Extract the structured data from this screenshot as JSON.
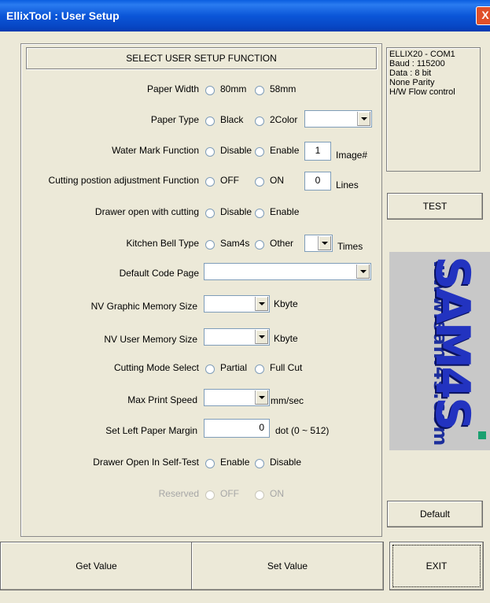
{
  "window": {
    "title": "EllixTool : User Setup",
    "close_glyph": "X"
  },
  "header": {
    "text": "SELECT USER SETUP FUNCTION"
  },
  "info": {
    "lines": [
      "ELLIX20 - COM1",
      "Baud : 115200",
      "Data : 8 bit",
      "None Parity",
      "H/W Flow control"
    ]
  },
  "buttons": {
    "test": "TEST",
    "default": "Default",
    "exit": "EXIT",
    "get_value": "Get Value",
    "set_value": "Set Value"
  },
  "logo": {
    "url": "www.sam4s.com",
    "brand": "SAM4S"
  },
  "rows": {
    "paper_width": {
      "label": "Paper Width",
      "opt1": "80mm",
      "opt2": "58mm"
    },
    "paper_type": {
      "label": "Paper Type",
      "opt1": "Black",
      "opt2": "2Color",
      "select": ""
    },
    "water_mark": {
      "label": "Water Mark Function",
      "opt1": "Disable",
      "opt2": "Enable",
      "value": "1",
      "unit": "Image#"
    },
    "cutting_pos": {
      "label": "Cutting postion adjustment Function",
      "opt1": "OFF",
      "opt2": "ON",
      "value": "0",
      "unit": "Lines"
    },
    "drawer_cut": {
      "label": "Drawer open with cutting",
      "opt1": "Disable",
      "opt2": "Enable"
    },
    "kitchen_bell": {
      "label": "Kitchen Bell Type",
      "opt1": "Sam4s",
      "opt2": "Other",
      "select": "",
      "unit": "Times"
    },
    "code_page": {
      "label": "Default Code Page",
      "select": ""
    },
    "nv_graphic": {
      "label": "NV Graphic Memory Size",
      "select": "",
      "unit": "Kbyte"
    },
    "nv_user": {
      "label": "NV User Memory Size",
      "select": "",
      "unit": "Kbyte"
    },
    "cutting_mode": {
      "label": "Cutting Mode Select",
      "opt1": "Partial",
      "opt2": "Full Cut"
    },
    "max_speed": {
      "label": "Max Print Speed",
      "select": "",
      "unit": "mm/sec"
    },
    "left_margin": {
      "label": "Set Left Paper Margin",
      "value": "0",
      "unit": "dot (0 ~ 512)"
    },
    "drawer_selftest": {
      "label": "Drawer Open In Self-Test",
      "opt1": "Enable",
      "opt2": "Disable"
    },
    "reserved": {
      "label": "Reserved",
      "opt1": "OFF",
      "opt2": "ON"
    }
  }
}
